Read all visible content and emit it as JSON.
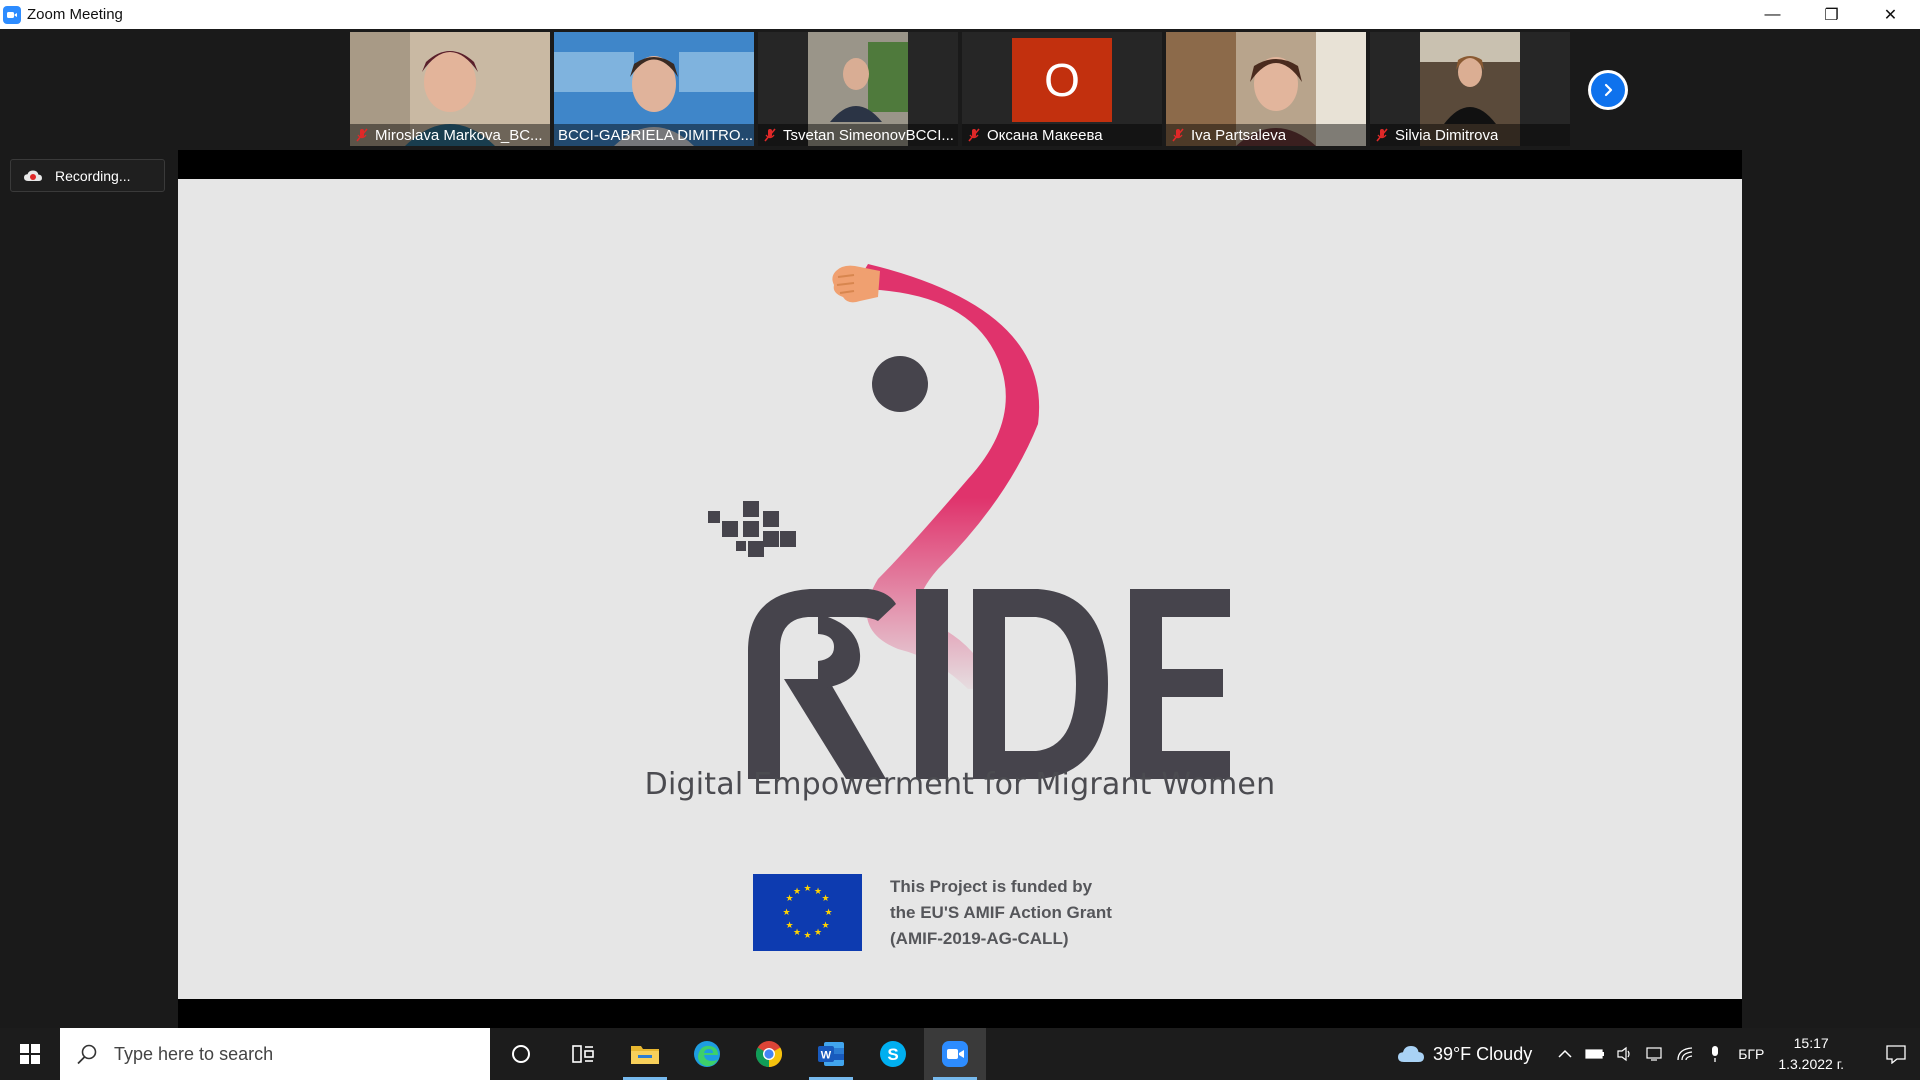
{
  "window": {
    "title": "Zoom Meeting"
  },
  "participants": [
    {
      "name": "Miroslava Markova_BC...",
      "muted": true,
      "active": false
    },
    {
      "name": "BCCI-GABRIELA DIMITRO...",
      "muted": false,
      "active": true
    },
    {
      "name": "Tsvetan SimeonovBCCI...",
      "muted": true,
      "active": false
    },
    {
      "name": "Оксана Макеева",
      "muted": true,
      "active": false,
      "avatar_letter": "O"
    },
    {
      "name": "Iva Partsaleva",
      "muted": true,
      "active": false
    },
    {
      "name": "Silvia Dimitrova",
      "muted": true,
      "active": false
    }
  ],
  "recording": {
    "label": "Recording..."
  },
  "slide": {
    "logo_text": "RIDE",
    "tagline": "Digital Empowerment for Migrant Women",
    "funding_lines": [
      "This Project is funded by",
      "the EU'S AMIF Action Grant",
      "(AMIF-2019-AG-CALL)"
    ]
  },
  "taskbar": {
    "search_placeholder": "Type here to search",
    "apps": [
      "cortana-icon",
      "task-view-icon",
      "file-explorer-icon",
      "edge-icon",
      "chrome-icon",
      "word-icon",
      "skype-icon",
      "zoom-icon"
    ],
    "weather": "39°F  Cloudy",
    "language": "БГР",
    "time": "15:17",
    "date": "1.3.2022 г."
  },
  "colors": {
    "zoom_blue": "#2d8cff",
    "active_speaker": "#23d959",
    "ride_pink": "#e0336c",
    "ride_dark": "#46444c",
    "eu_blue": "#0d3bb0"
  }
}
